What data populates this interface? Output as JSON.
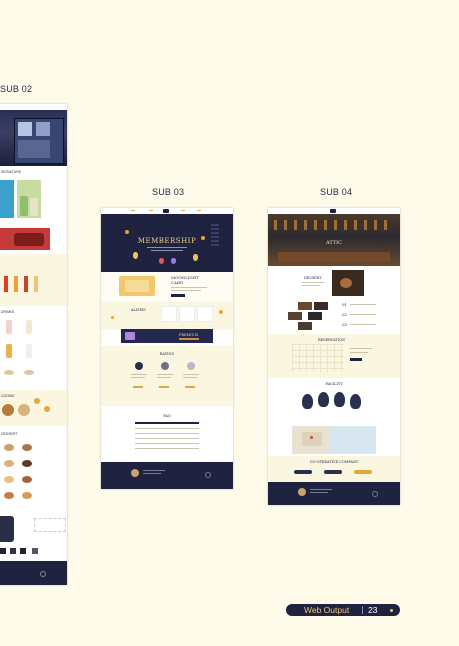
{
  "labels": {
    "sub02": "SUB 02",
    "sub03": "SUB 03",
    "sub04": "SUB 04"
  },
  "footer": {
    "text": "Web Output",
    "page": "23"
  },
  "sub03": {
    "hero_title": "MEMBERSHIP",
    "card_title": "MOONLIGHT CARD",
    "section1": "ALISMS",
    "premium": "PREMIUM",
    "rating": "RATING",
    "faq": "FAQ"
  },
  "sub04": {
    "hero_title": "ATTIC",
    "section1": "DESSERT",
    "section2": "RESERVATION",
    "section3": "FACILITY",
    "section4": "CO-OPERATIVE COMPANY"
  },
  "sub02": {
    "section1": "SIGNATURE",
    "section2": "DRINKS",
    "section3": "COOKIE",
    "section4": "DESSERT"
  },
  "colors": {
    "background": "#fefbea",
    "navy": "#1f2340",
    "accent": "#e0a93a"
  }
}
